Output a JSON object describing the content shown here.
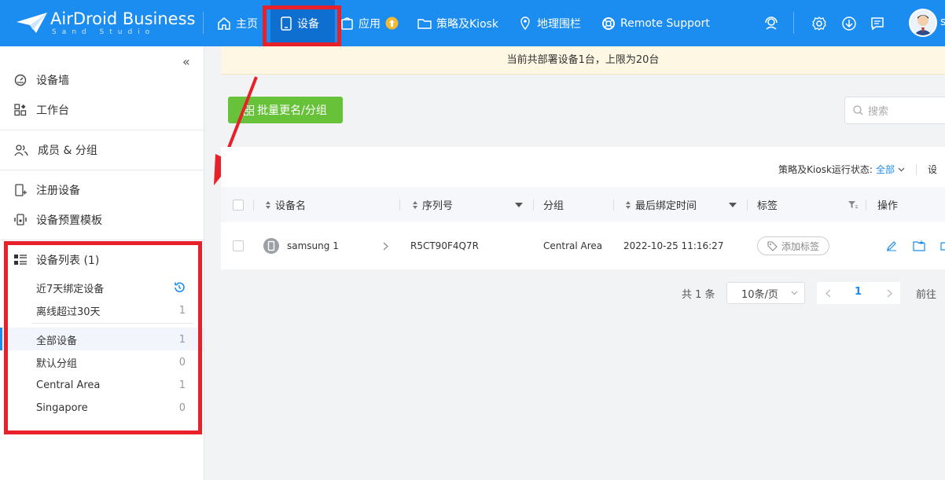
{
  "header": {
    "brand": "AirDroid Business",
    "brand_sub": "Sand Studio",
    "nav": {
      "home": "主页",
      "devices": "设备",
      "apps": "应用",
      "policy": "策略及Kiosk",
      "geofence": "地理围栏",
      "remote": "Remote Support"
    },
    "icons": [
      "home-icon",
      "tablet-icon",
      "bag-icon",
      "folder-icon",
      "map-pin-icon",
      "lifebuoy-icon",
      "headset-icon",
      "gear-icon",
      "download-icon",
      "message-icon"
    ],
    "avatar_suffix": "s"
  },
  "sidebar": {
    "device_wall": "设备墙",
    "workbench": "工作台",
    "members": "成员 & 分组",
    "enroll": "注册设备",
    "template": "设备预置模板",
    "device_list": {
      "title": "设备列表 (1)",
      "recent": "近7天绑定设备",
      "offline": {
        "label": "离线超过30天",
        "count": "1"
      },
      "all": {
        "label": "全部设备",
        "count": "1"
      },
      "default_group": {
        "label": "默认分组",
        "count": "0"
      },
      "central": {
        "label": "Central Area",
        "count": "1"
      },
      "singapore": {
        "label": "Singapore",
        "count": "0"
      }
    }
  },
  "main": {
    "banner": "当前共部署设备1台，上限为20台",
    "batch_button": "批量更名/分组",
    "search_placeholder": "搜索",
    "filter_label": "策略及Kiosk运行状态:",
    "filter_value": "全部",
    "filter_more": "设",
    "columns": {
      "name": "设备名",
      "serial": "序列号",
      "group": "分组",
      "last_bind": "最后绑定时间",
      "tags": "标签",
      "actions": "操作"
    },
    "rows": [
      {
        "name": "samsung 1",
        "serial": "R5CT90F4Q7R",
        "group": "Central Area",
        "last_bind": "2022-10-25 11:16:27",
        "tag_button": "添加标签"
      }
    ],
    "pager": {
      "total": "共 1 条",
      "page_size": "10条/页",
      "current": "1",
      "goto": "前往"
    }
  },
  "colors": {
    "topbar": "#1b8cf0",
    "active_nav": "#0f6fd0",
    "highlight_box": "#e8202a",
    "batch_button": "#67c23a",
    "banner_bg": "#fdf7e3"
  }
}
